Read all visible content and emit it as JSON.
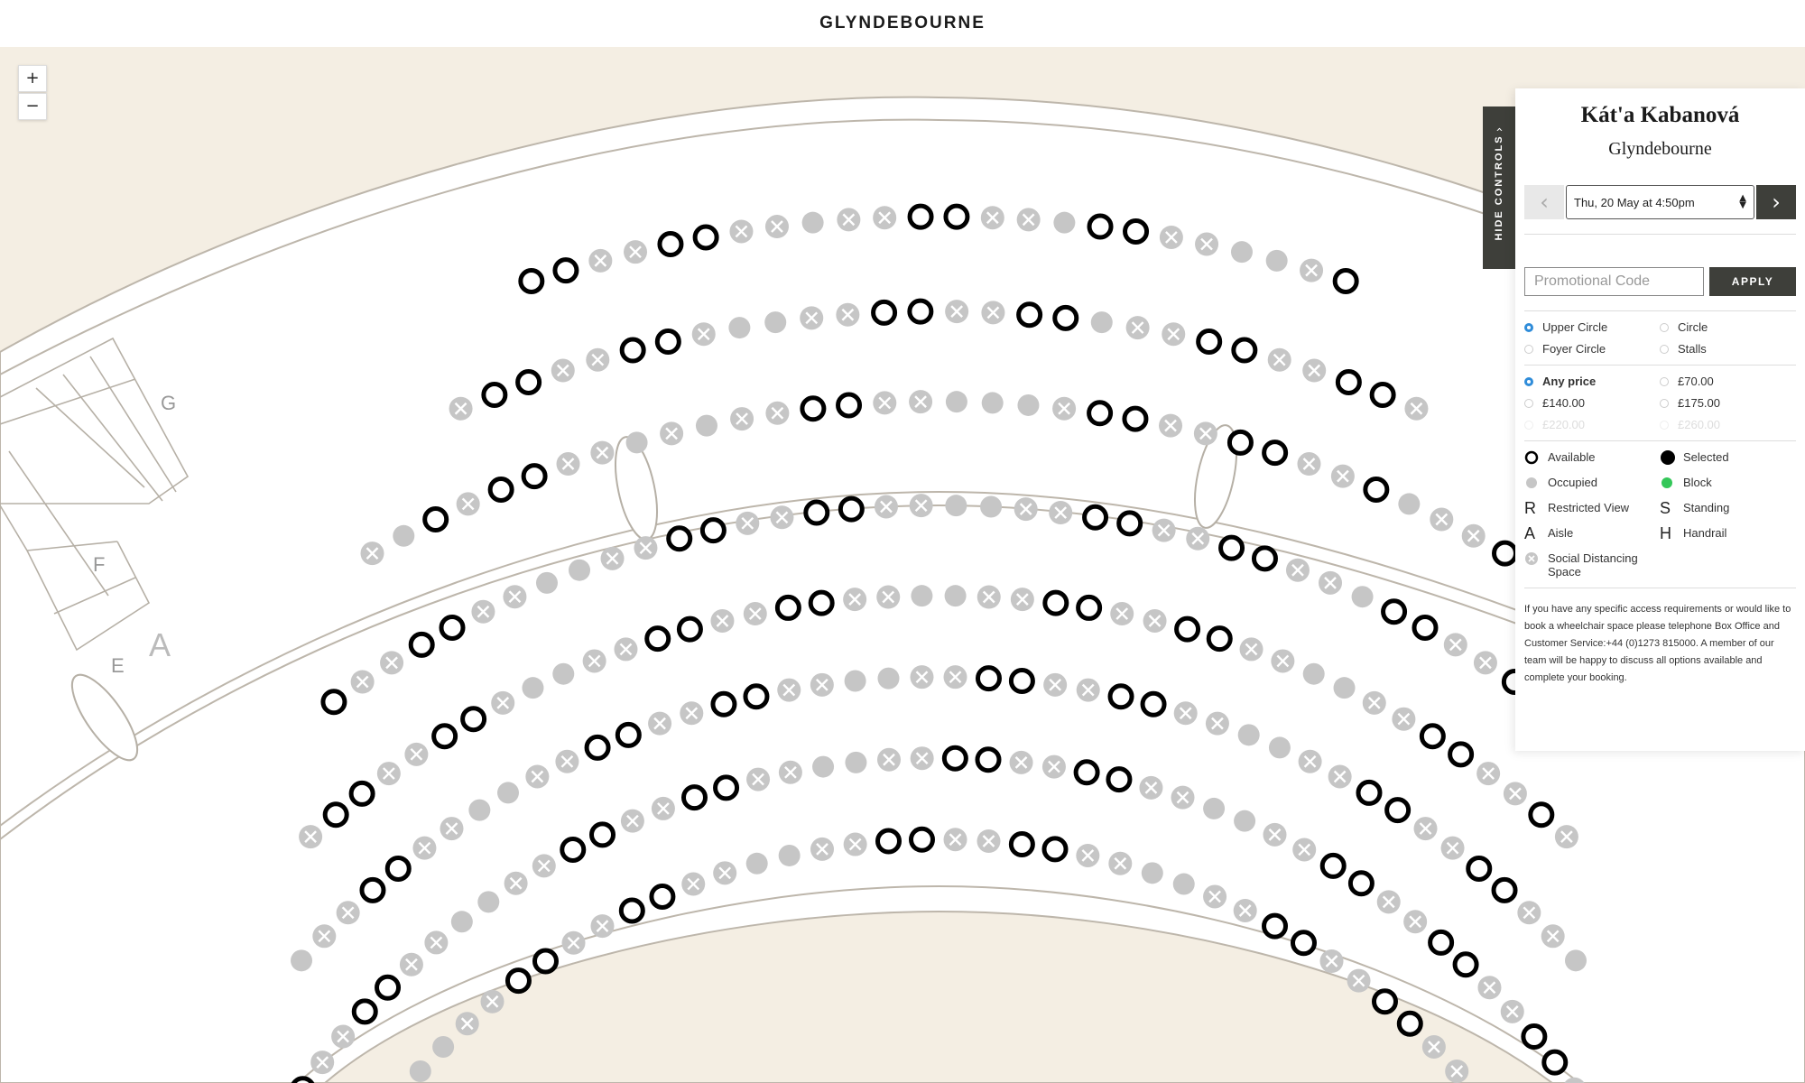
{
  "header": {
    "logo": "GLYNDEBOURNE"
  },
  "map": {
    "zoom_in": "+",
    "zoom_out": "−",
    "row_labels": [
      "G",
      "F",
      "E",
      "A"
    ]
  },
  "colors": {
    "background_beige": "#f4eee3",
    "available": "#000000",
    "occupied": "#c6c6c6",
    "block": "#34c759",
    "dark_button": "#3e3f3a",
    "radio_checked": "#2f8cd9"
  },
  "controls_tab": {
    "label": "HIDE CONTROLS",
    "chevron": "‹"
  },
  "panel": {
    "title": "Kát'a Kabanová",
    "venue": "Glyndebourne",
    "date_prev": "‹",
    "date_next": "›",
    "date_selected": "Thu, 20 May at 4:50pm",
    "promo_placeholder": "Promotional Code",
    "apply_label": "APPLY",
    "areas": [
      {
        "label": "Upper Circle",
        "checked": true
      },
      {
        "label": "Circle",
        "checked": false
      },
      {
        "label": "Foyer Circle",
        "checked": false
      },
      {
        "label": "Stalls",
        "checked": false
      }
    ],
    "prices": [
      {
        "label": "Any price",
        "checked": true
      },
      {
        "label": "£70.00",
        "checked": false
      },
      {
        "label": "£140.00",
        "checked": false
      },
      {
        "label": "£175.00",
        "checked": false
      },
      {
        "label": "£220.00",
        "checked": false,
        "disabled": true
      },
      {
        "label": "£260.00",
        "checked": false,
        "disabled": true
      }
    ],
    "legend": [
      {
        "symbol": "ring",
        "label": "Available"
      },
      {
        "symbol": "filled-black",
        "label": "Selected"
      },
      {
        "symbol": "filled-grey",
        "label": "Occupied"
      },
      {
        "symbol": "filled-green",
        "label": "Block"
      },
      {
        "symbol": "R",
        "label": "Restricted View"
      },
      {
        "symbol": "S",
        "label": "Standing"
      },
      {
        "symbol": "A",
        "label": "Aisle"
      },
      {
        "symbol": "H",
        "label": "Handrail"
      },
      {
        "symbol": "cross",
        "label": "Social Distancing Space"
      }
    ],
    "access_note": "If you have any specific access requirements or would like to book a wheelchair space please telephone Box Office and Customer Service:+44 (0)1273 815000. A member of our team will be happy to discuss all options available and complete your booking."
  }
}
